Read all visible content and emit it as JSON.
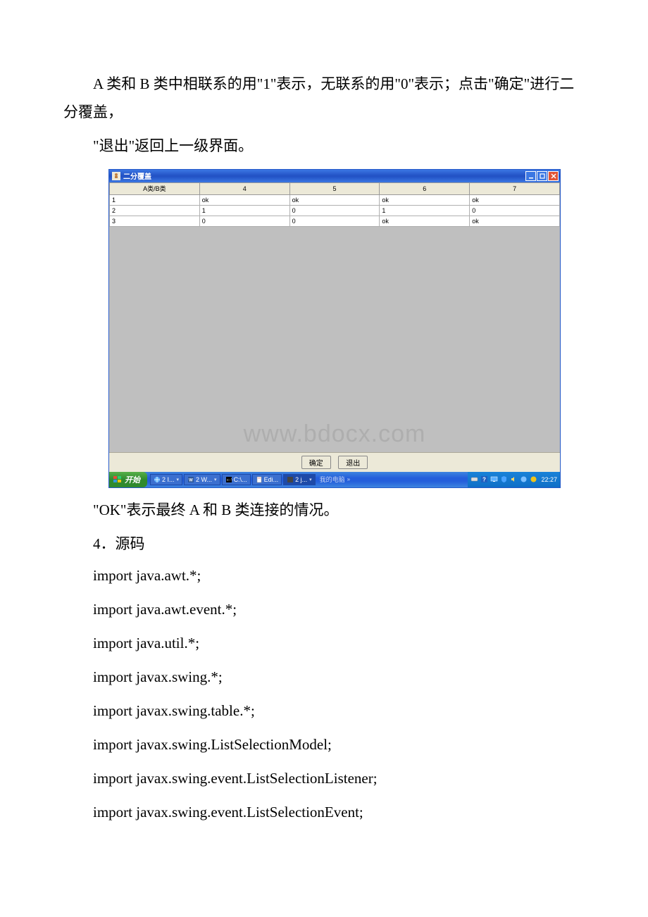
{
  "paragraphs": {
    "p1": "A 类和 B 类中相联系的用\"1\"表示，无联系的用\"0\"表示；点击\"确定\"进行二分覆盖，",
    "p2": "\"退出\"返回上一级界面。",
    "p3": "\"OK\"表示最终 A 和 B 类连接的情况。",
    "section": "4．源码"
  },
  "code_lines": [
    "import java.awt.*;",
    "import java.awt.event.*;",
    "import java.util.*;",
    "import javax.swing.*;",
    "import javax.swing.table.*;",
    "",
    "import javax.swing.ListSelectionModel;",
    "import javax.swing.event.ListSelectionListener;",
    "import javax.swing.event.ListSelectionEvent;"
  ],
  "window": {
    "title": "二分覆盖",
    "headers": [
      "A类/B类",
      "4",
      "5",
      "6",
      "7"
    ],
    "rows": [
      [
        "1",
        "ok",
        "ok",
        "ok",
        "ok"
      ],
      [
        "2",
        "1",
        "0",
        "1",
        "0"
      ],
      [
        "3",
        "0",
        "0",
        "ok",
        "ok"
      ]
    ],
    "watermark": "www.bdocx.com",
    "buttons": {
      "ok": "确定",
      "exit": "退出"
    }
  },
  "taskbar": {
    "start": "开始",
    "items": [
      {
        "label": "2 I..."
      },
      {
        "label": "2 W..."
      },
      {
        "label": "C:\\..."
      },
      {
        "label": "Edi..."
      },
      {
        "label": "2 j..."
      }
    ],
    "tray_label": "我的电脑",
    "time": "22:27"
  }
}
